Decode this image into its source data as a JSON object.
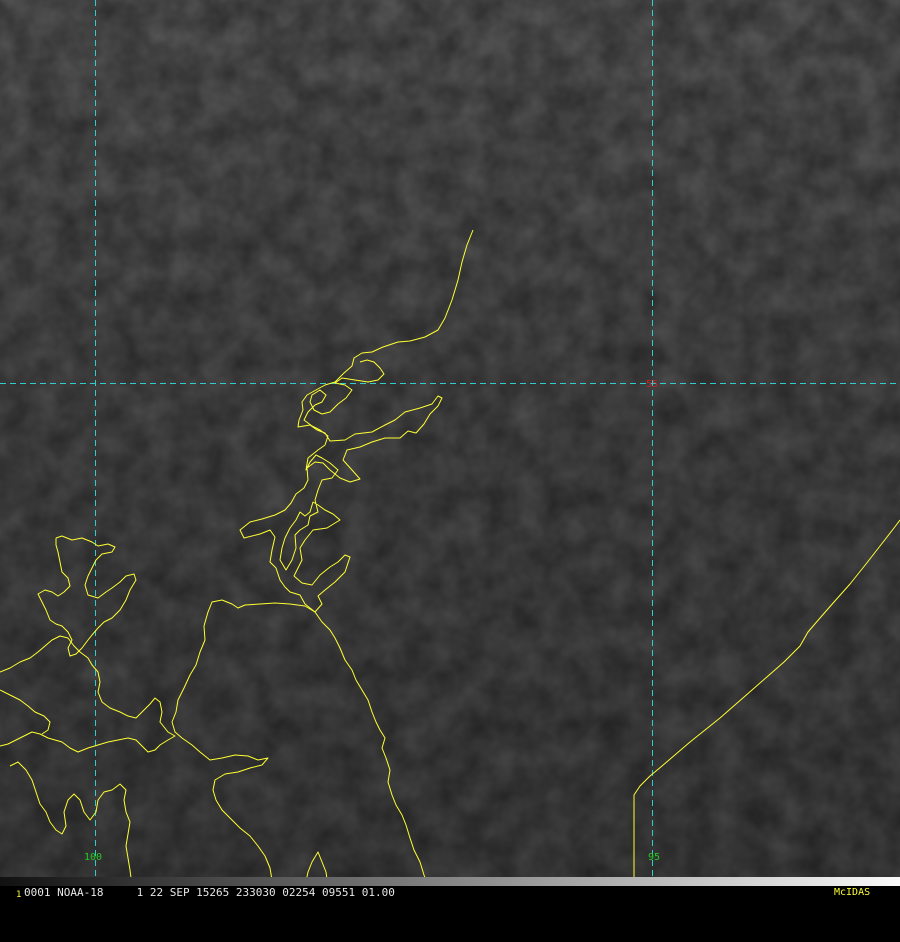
{
  "map": {
    "graticule_labels": {
      "lat_55": "55",
      "lon_100": "100",
      "lon_95": "95"
    },
    "colors": {
      "background": "#2a2a2a",
      "coastline": "#ffff33",
      "gridline": "#33cccc",
      "lat_label": "#cc2222",
      "lon_label": "#22cc22"
    }
  },
  "status_bar": {
    "frame_number": "1",
    "info_text": "0001 NOAA-18     1 22 SEP 15265 233030 02254 09551 01.00",
    "brand": "McIDAS"
  }
}
